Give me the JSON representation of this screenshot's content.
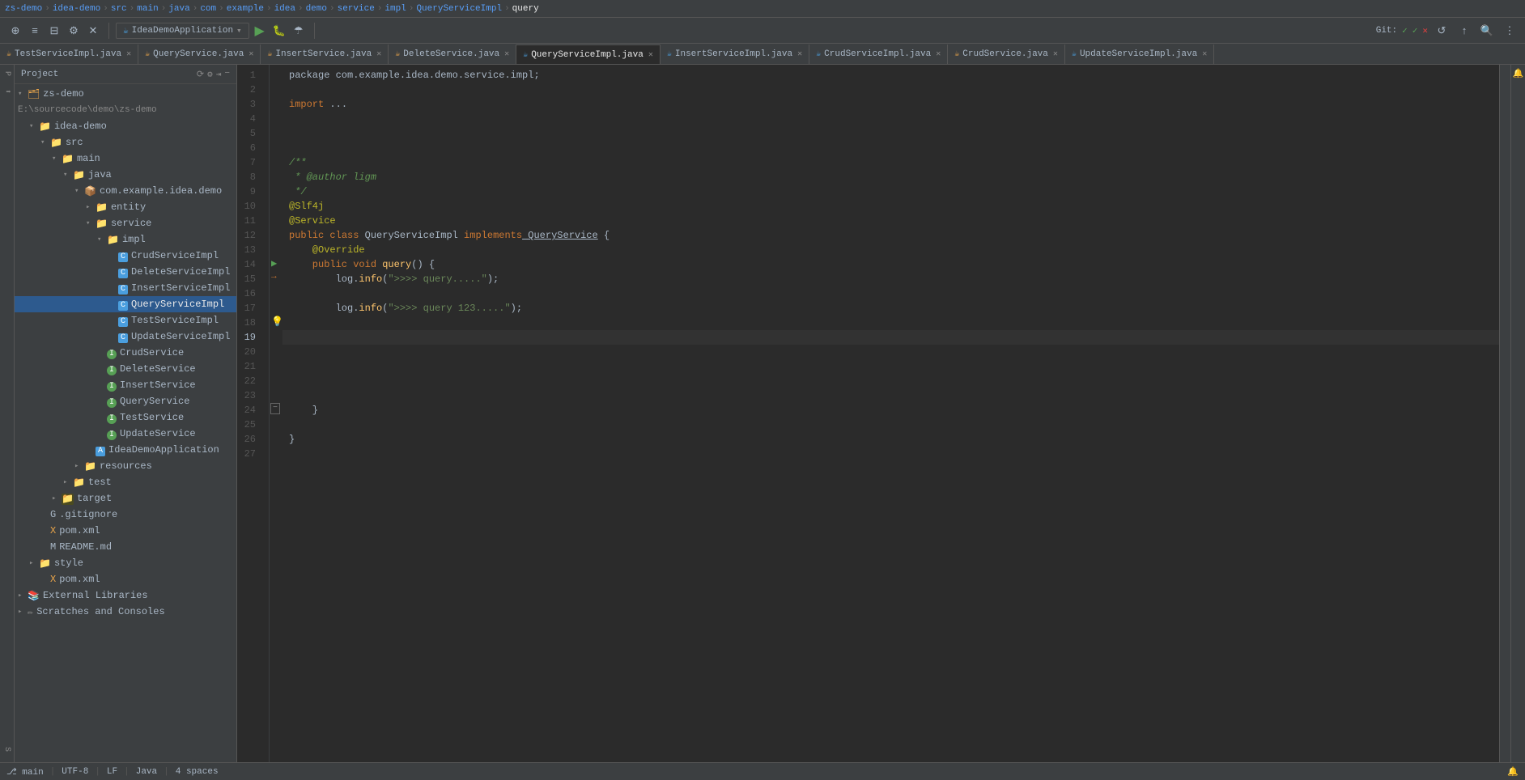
{
  "topbar": {
    "breadcrumb": [
      "zs-demo",
      "idea-demo",
      "src",
      "main",
      "java",
      "com",
      "example",
      "idea",
      "demo",
      "service",
      "impl",
      "QueryServiceImpl",
      "query"
    ]
  },
  "toolbar": {
    "app_name": "IdeaDemoApplication",
    "project_label": "Project"
  },
  "tabs": [
    {
      "id": "TestServiceImpl",
      "label": "TestServiceImpl.java",
      "icon": "java",
      "active": false
    },
    {
      "id": "QueryService",
      "label": "QueryService.java",
      "icon": "java",
      "active": false
    },
    {
      "id": "InsertService",
      "label": "InsertService.java",
      "icon": "java",
      "active": false
    },
    {
      "id": "DeleteService",
      "label": "DeleteService.java",
      "icon": "java",
      "active": false
    },
    {
      "id": "QueryServiceImpl",
      "label": "QueryServiceImpl.java",
      "icon": "impl",
      "active": true
    },
    {
      "id": "InsertServiceImpl",
      "label": "InsertServiceImpl.java",
      "icon": "impl",
      "active": false
    },
    {
      "id": "CrudServiceImpl",
      "label": "CrudServiceImpl.java",
      "icon": "impl",
      "active": false
    },
    {
      "id": "CrudService",
      "label": "CrudService.java",
      "icon": "java",
      "active": false
    },
    {
      "id": "UpdateServiceImpl",
      "label": "UpdateServiceImpl.java",
      "icon": "impl",
      "active": false
    }
  ],
  "tree": {
    "header": "Project",
    "items": [
      {
        "id": "zs-demo",
        "label": "zs-demo",
        "indent": 0,
        "type": "root",
        "expanded": true
      },
      {
        "id": "idea-demo-path",
        "label": "E:\\sourcecode\\demo\\zs-demo",
        "indent": 0,
        "type": "path"
      },
      {
        "id": "idea-demo",
        "label": "idea-demo",
        "indent": 1,
        "type": "folder",
        "expanded": true
      },
      {
        "id": "src",
        "label": "src",
        "indent": 2,
        "type": "folder",
        "expanded": true
      },
      {
        "id": "main",
        "label": "main",
        "indent": 3,
        "type": "folder",
        "expanded": true
      },
      {
        "id": "java",
        "label": "java",
        "indent": 4,
        "type": "folder",
        "expanded": true
      },
      {
        "id": "com.example.idea.demo",
        "label": "com.example.idea.demo",
        "indent": 5,
        "type": "package",
        "expanded": true
      },
      {
        "id": "entity",
        "label": "entity",
        "indent": 6,
        "type": "folder",
        "expanded": false
      },
      {
        "id": "service",
        "label": "service",
        "indent": 6,
        "type": "folder",
        "expanded": true
      },
      {
        "id": "impl",
        "label": "impl",
        "indent": 7,
        "type": "folder",
        "expanded": true
      },
      {
        "id": "CrudServiceImpl",
        "label": "CrudServiceImpl",
        "indent": 8,
        "type": "class"
      },
      {
        "id": "DeleteServiceImpl",
        "label": "DeleteServiceImpl",
        "indent": 8,
        "type": "class"
      },
      {
        "id": "InsertServiceImpl",
        "label": "InsertServiceImpl",
        "indent": 8,
        "type": "class"
      },
      {
        "id": "QueryServiceImpl",
        "label": "QueryServiceImpl",
        "indent": 8,
        "type": "class",
        "selected": true
      },
      {
        "id": "TestServiceImpl",
        "label": "TestServiceImpl",
        "indent": 8,
        "type": "class"
      },
      {
        "id": "UpdateServiceImpl",
        "label": "UpdateServiceImpl",
        "indent": 8,
        "type": "class"
      },
      {
        "id": "CrudService",
        "label": "CrudService",
        "indent": 7,
        "type": "interface"
      },
      {
        "id": "DeleteService",
        "label": "DeleteService",
        "indent": 7,
        "type": "interface"
      },
      {
        "id": "InsertService",
        "label": "InsertService",
        "indent": 7,
        "type": "interface"
      },
      {
        "id": "QueryService",
        "label": "QueryService",
        "indent": 7,
        "type": "interface"
      },
      {
        "id": "TestService",
        "label": "TestService",
        "indent": 7,
        "type": "interface"
      },
      {
        "id": "UpdateService",
        "label": "UpdateService",
        "indent": 7,
        "type": "interface"
      },
      {
        "id": "IdeaDemoApplication",
        "label": "IdeaDemoApplication",
        "indent": 6,
        "type": "app"
      },
      {
        "id": "resources",
        "label": "resources",
        "indent": 5,
        "type": "folder",
        "expanded": false
      },
      {
        "id": "test",
        "label": "test",
        "indent": 4,
        "type": "folder",
        "expanded": false
      },
      {
        "id": "target",
        "label": "target",
        "indent": 3,
        "type": "folder",
        "expanded": false,
        "highlight": true
      },
      {
        "id": "gitignore",
        "label": ".gitignore",
        "indent": 2,
        "type": "git"
      },
      {
        "id": "pom-idea",
        "label": "pom.xml",
        "indent": 2,
        "type": "xml"
      },
      {
        "id": "readme",
        "label": "README.md",
        "indent": 2,
        "type": "md"
      },
      {
        "id": "style",
        "label": "style",
        "indent": 1,
        "type": "folder",
        "expanded": false
      },
      {
        "id": "pom-root",
        "label": "pom.xml",
        "indent": 2,
        "type": "xml"
      },
      {
        "id": "external-libs",
        "label": "External Libraries",
        "indent": 0,
        "type": "ext"
      },
      {
        "id": "scratches",
        "label": "Scratches and Consoles",
        "indent": 0,
        "type": "scratches"
      }
    ]
  },
  "code": {
    "filename": "QueryServiceImpl.java",
    "lines": [
      {
        "num": 1,
        "tokens": [
          {
            "t": "pkg",
            "v": "package com.example.idea.demo.service.impl;"
          }
        ]
      },
      {
        "num": 2,
        "tokens": []
      },
      {
        "num": 3,
        "tokens": [
          {
            "t": "kw",
            "v": "import"
          },
          {
            "t": "op",
            "v": " ..."
          },
          {
            "t": "op",
            "v": ""
          }
        ]
      },
      {
        "num": 4,
        "tokens": []
      },
      {
        "num": 5,
        "tokens": []
      },
      {
        "num": 6,
        "tokens": []
      },
      {
        "num": 7,
        "tokens": [
          {
            "t": "cmt",
            "v": "/**"
          }
        ]
      },
      {
        "num": 8,
        "tokens": [
          {
            "t": "cmt",
            "v": " * @author ligm"
          }
        ]
      },
      {
        "num": 9,
        "tokens": [
          {
            "t": "cmt",
            "v": " */"
          }
        ]
      },
      {
        "num": 10,
        "tokens": [
          {
            "t": "ann",
            "v": "@Slf4j"
          }
        ]
      },
      {
        "num": 11,
        "tokens": [
          {
            "t": "ann",
            "v": "@Service"
          }
        ]
      },
      {
        "num": 12,
        "tokens": [
          {
            "t": "kw2",
            "v": "public"
          },
          {
            "t": "kw2",
            "v": " class"
          },
          {
            "t": "cls",
            "v": " QueryServiceImpl"
          },
          {
            "t": "kw",
            "v": " implements"
          },
          {
            "t": "iface",
            "v": " QueryService"
          },
          {
            "t": "bracket",
            "v": " {"
          }
        ]
      },
      {
        "num": 13,
        "tokens": [
          {
            "t": "ann",
            "v": "    @Override"
          }
        ]
      },
      {
        "num": 14,
        "tokens": [
          {
            "t": "kw2",
            "v": "    public"
          },
          {
            "t": "kw",
            "v": " void"
          },
          {
            "t": "fn",
            "v": " query"
          },
          {
            "t": "bracket",
            "v": "()"
          },
          {
            "t": "bracket",
            "v": " {"
          }
        ]
      },
      {
        "num": 15,
        "tokens": [
          {
            "t": "log",
            "v": "        log."
          },
          {
            "t": "fn",
            "v": "info"
          },
          {
            "t": "bracket",
            "v": "("
          },
          {
            "t": "str",
            "v": "\">>>> query.....\""
          }
        ],
        "hasArrow": true
      },
      {
        "num": 16,
        "tokens": []
      },
      {
        "num": 17,
        "tokens": [
          {
            "t": "log",
            "v": "        log."
          },
          {
            "t": "fn",
            "v": "info"
          },
          {
            "t": "bracket",
            "v": "("
          },
          {
            "t": "str",
            "v": "\">>>> query 123.....\""
          }
        ]
      },
      {
        "num": 18,
        "tokens": [],
        "hasBulb": true
      },
      {
        "num": 19,
        "tokens": [],
        "active": true
      },
      {
        "num": 20,
        "tokens": []
      },
      {
        "num": 21,
        "tokens": []
      },
      {
        "num": 22,
        "tokens": []
      },
      {
        "num": 23,
        "tokens": []
      },
      {
        "num": 24,
        "tokens": [
          {
            "t": "bracket",
            "v": "    }"
          }
        ]
      },
      {
        "num": 25,
        "tokens": []
      },
      {
        "num": 26,
        "tokens": [
          {
            "t": "bracket",
            "v": "}"
          }
        ]
      },
      {
        "num": 27,
        "tokens": []
      }
    ]
  },
  "statusbar": {
    "items": [
      "UTF-8",
      "LF",
      "Java",
      "4 spaces",
      "Git: main"
    ]
  }
}
